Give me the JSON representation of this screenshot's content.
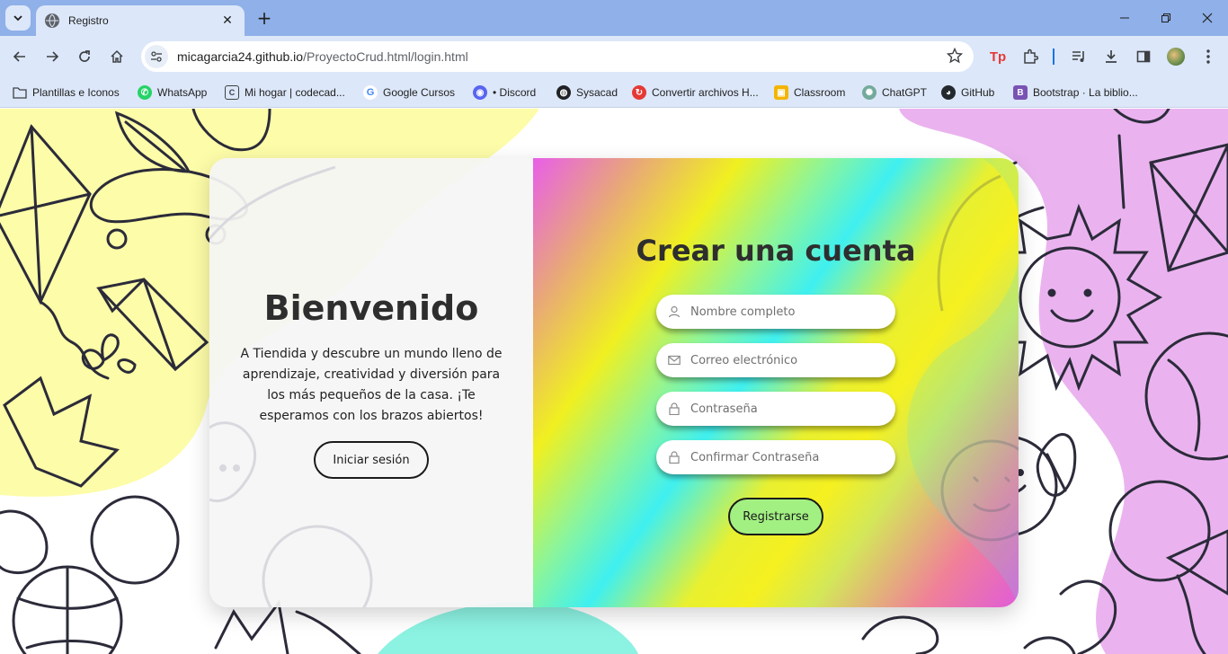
{
  "browser": {
    "tab_title": "Registro",
    "url_host": "micagarcia24.github.io",
    "url_path": "/ProyectoCrud.html/login.html",
    "bookmarks": [
      {
        "label": "Plantillas e Iconos",
        "icon": "folder-icon",
        "color": "#5f6368"
      },
      {
        "label": "WhatsApp",
        "icon": "whatsapp-icon",
        "color": "#25d366"
      },
      {
        "label": "Mi hogar | codecad...",
        "icon": "codecademy-icon",
        "color": "#3c4043"
      },
      {
        "label": "Google Cursos",
        "icon": "google-icon",
        "color": "#4285f4"
      },
      {
        "label": "• Discord",
        "icon": "discord-icon",
        "color": "#5865f2"
      },
      {
        "label": "Sysacad",
        "icon": "globe-icon",
        "color": "#202124"
      },
      {
        "label": "Convertir archivos H...",
        "icon": "convert-icon",
        "color": "#e53935"
      },
      {
        "label": "Classroom",
        "icon": "classroom-icon",
        "color": "#f4b400"
      },
      {
        "label": "ChatGPT",
        "icon": "chatgpt-icon",
        "color": "#74aa9c"
      },
      {
        "label": "GitHub",
        "icon": "github-icon",
        "color": "#24292e"
      },
      {
        "label": "Bootstrap · La biblio...",
        "icon": "bootstrap-icon",
        "color": "#7952b3"
      }
    ]
  },
  "welcome_panel": {
    "title": "Bienvenido",
    "description": "A Tiendida y descubre un mundo lleno de aprendizaje, creatividad y diversión para los más pequeños de la casa. ¡Te esperamos con los brazos abiertos!",
    "login_button": "Iniciar sesión"
  },
  "register_form": {
    "title": "Crear una cuenta",
    "fields": [
      {
        "placeholder": "Nombre completo",
        "value": "",
        "icon": "user-icon"
      },
      {
        "placeholder": "Correo electrónico",
        "value": "",
        "icon": "envelope-icon"
      },
      {
        "placeholder": "Contraseña",
        "value": "",
        "icon": "lock-icon"
      },
      {
        "placeholder": "Confirmar Contraseña",
        "value": "",
        "icon": "lock-icon"
      }
    ],
    "submit_button": "Registrarse"
  },
  "colors": {
    "chrome_frame": "#8fb0e8",
    "chrome_toolbar": "#dce7f9",
    "register_button": "#a2f082",
    "blob_yellow": "#fdfca8",
    "blob_pink": "#eab3ef",
    "blob_teal": "#8cf2e2"
  }
}
